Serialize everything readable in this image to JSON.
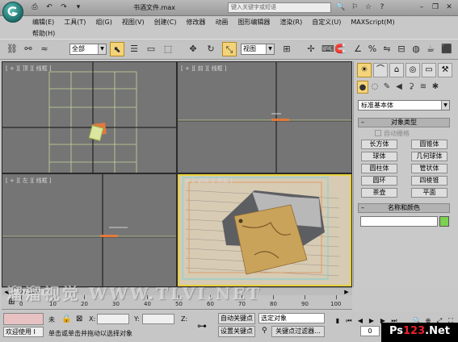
{
  "title": {
    "quick_access": [
      "⎙",
      "↶",
      "↷",
      "▾"
    ],
    "document": "书酒文件",
    "extension": ".max",
    "search_placeholder": "键入关键字或短语",
    "right_icons": [
      "🔍",
      "⚐",
      "☆",
      "?"
    ],
    "window_controls": {
      "minimize": "–",
      "restore": "❐",
      "close": "✕"
    }
  },
  "menu": {
    "items": [
      "编辑(E)",
      "工具(T)",
      "组(G)",
      "视图(V)",
      "创建(C)",
      "修改器",
      "动画",
      "图形编辑器",
      "渲染(R)",
      "自定义(U)",
      "MAXScript(M)"
    ],
    "help": "帮助(H)"
  },
  "toolbar": {
    "selection_filter": "全部",
    "ref_coord": "视图"
  },
  "viewports": {
    "top": "[ + ][ 顶 ][ 线框 ]",
    "front": "[ + ][ 前 ][ 线框 ]",
    "left": "[ + ][ 左 ][ 线框 ]",
    "perspective": "[ + ][ 透视 ][ 真实 ]"
  },
  "command_panel": {
    "category": "标准基本体",
    "object_type_title": "对象类型",
    "autogrid_label": "自动栅格",
    "objects": [
      "长方体",
      "圆锥体",
      "球体",
      "几何球体",
      "圆柱体",
      "管状体",
      "圆环",
      "四棱锥",
      "茶壶",
      "平面"
    ],
    "name_color_title": "名称和颜色",
    "swatch_color": "#7cd14e"
  },
  "timeline": {
    "frame_display": "0 / 100",
    "ticks": [
      "0",
      "10",
      "20",
      "30",
      "40",
      "50",
      "60",
      "70",
      "80",
      "90",
      "100"
    ]
  },
  "status": {
    "selection_none": "未",
    "x_label": "X:",
    "y_label": "Y:",
    "z_label": "Z:",
    "auto_key": "自动关键点",
    "set_key": "设置关键点",
    "selected_object": "选定对象",
    "key_filters": "关键点过滤器...",
    "frame": "0",
    "welcome": "欢迎使用 I",
    "prompt": "单击或单击并拖动以选择对象"
  },
  "watermark": "溜溜视觉 WWW.TLVI.NET",
  "corner_logo": {
    "prefix": "Ps",
    "middle": "123",
    "suffix": ".Net"
  }
}
